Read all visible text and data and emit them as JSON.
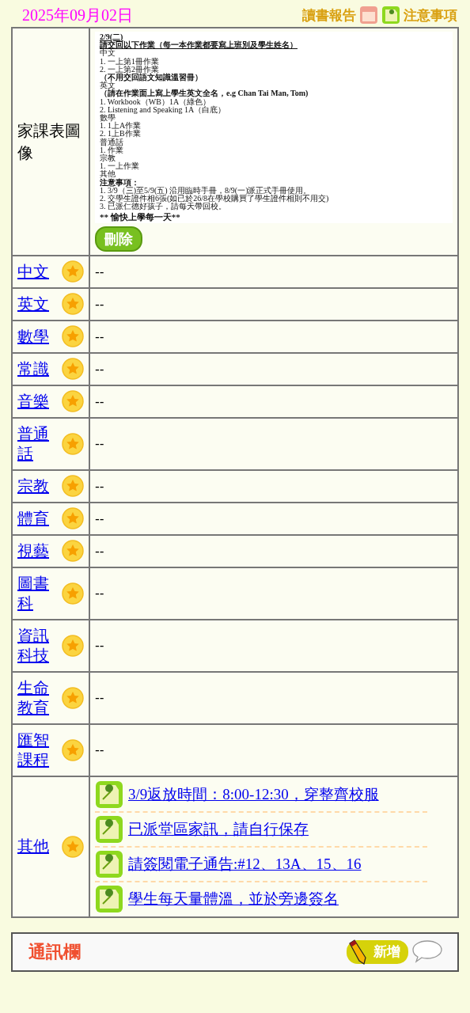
{
  "date": "2025年09月02日",
  "header": {
    "reading_report": "讀書報告",
    "notices": "注意事項"
  },
  "homework_image": {
    "label": "家課表圖像",
    "delete_button": "刪除",
    "lines": [
      {
        "kind": "heading",
        "text": "2/9(二)"
      },
      {
        "kind": "heading",
        "text": "請交回以下作業（每一本作業都要寫上班別及學生姓名）"
      },
      {
        "kind": "plain",
        "text": "中文"
      },
      {
        "kind": "plain",
        "text": "1. 一上第1冊作業"
      },
      {
        "kind": "plain",
        "text": "2. 一上第2冊作業"
      },
      {
        "kind": "bold",
        "text": "（不用交回語文知識溫習冊）"
      },
      {
        "kind": "plain",
        "text": "英文"
      },
      {
        "kind": "bold",
        "text": "（請在作業面上寫上學生英文全名，e.g Chan Tai Man, Tom)"
      },
      {
        "kind": "plain",
        "text": "1. Workbook（WB）1A（綠色）"
      },
      {
        "kind": "plain",
        "text": "2. Listening and Speaking 1A（白底）"
      },
      {
        "kind": "plain",
        "text": "數學"
      },
      {
        "kind": "plain",
        "text": "1. 1上A作業"
      },
      {
        "kind": "plain",
        "text": "2. 1上B作業"
      },
      {
        "kind": "plain",
        "text": "普通話"
      },
      {
        "kind": "plain",
        "text": "1. 作業"
      },
      {
        "kind": "plain",
        "text": "宗教"
      },
      {
        "kind": "plain",
        "text": "1. 一上作業"
      },
      {
        "kind": "plain",
        "text": "其他"
      },
      {
        "kind": "bold",
        "text": "注意事項："
      },
      {
        "kind": "plain",
        "text": "1. 3/9（三)至5/9(五) 沿用臨時手冊，8/9(一)派正式手冊使用。"
      },
      {
        "kind": "plain",
        "text": "2. 交學生證件相6張(如已於26/8在學校購買了學生證件相則不用交)"
      },
      {
        "kind": "plain",
        "text": "3. 已派仁德好孩子，請每天帶回校。"
      },
      {
        "kind": "closing",
        "text": "** 愉快上學每一天**"
      }
    ]
  },
  "subjects": [
    {
      "name": "中文",
      "content": "--"
    },
    {
      "name": "英文",
      "content": "--"
    },
    {
      "name": "數學",
      "content": "--"
    },
    {
      "name": "常識",
      "content": "--"
    },
    {
      "name": "音樂",
      "content": "--"
    },
    {
      "name": "普通話",
      "content": "--"
    },
    {
      "name": "宗教",
      "content": "--"
    },
    {
      "name": "體育",
      "content": "--"
    },
    {
      "name": "視藝",
      "content": "--"
    },
    {
      "name": "圖書科",
      "content": "--"
    },
    {
      "name": "資訊科技",
      "content": "--"
    },
    {
      "name": "生命教育",
      "content": "--"
    },
    {
      "name": "匯智課程",
      "content": "--"
    }
  ],
  "other": {
    "name": "其他",
    "items": [
      "3/9返放時間：8:00-12:30，穿整齊校服",
      "已派堂區家訊，請自行保存",
      "請簽閱電子通告:#12、13A、15、16",
      "學生每天量體溫，並於旁邊簽名"
    ]
  },
  "message_bar": {
    "title": "通訊欄",
    "add_button": "新增"
  }
}
